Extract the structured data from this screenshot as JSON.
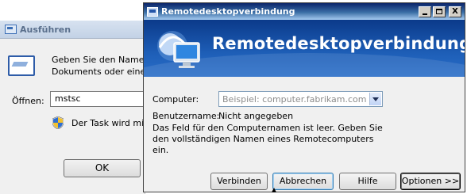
{
  "run_dialog": {
    "title": "Ausführen",
    "description_line1": "Geben Sie den Namen",
    "description_line2": "Dokuments oder eine",
    "open_label": "Öffnen:",
    "open_value": "mstsc",
    "task_text": "Der Task wird mi",
    "ok_label": "OK"
  },
  "rdp_dialog": {
    "window_title": "Remotedesktopverbindung",
    "banner_title": "Remotedesktopverbindung",
    "computer_label": "Computer:",
    "computer_placeholder": "Beispiel: computer.fabrikam.com",
    "username_label": "Benutzername:",
    "username_value": "Nicht angegeben",
    "message": "Das Feld für den Computernamen ist leer. Geben Sie den vollständigen Namen eines Remotecomputers ein.",
    "buttons": {
      "connect": "Verbinden",
      "cancel": "Abbrechen",
      "help": "Hilfe",
      "options": "Optionen >>"
    },
    "titlebar_buttons": {
      "close": "X"
    }
  },
  "colors": {
    "banner": "#1e5fb8",
    "titlebar_start": "#0a246a",
    "titlebar_end": "#a6caf0"
  }
}
